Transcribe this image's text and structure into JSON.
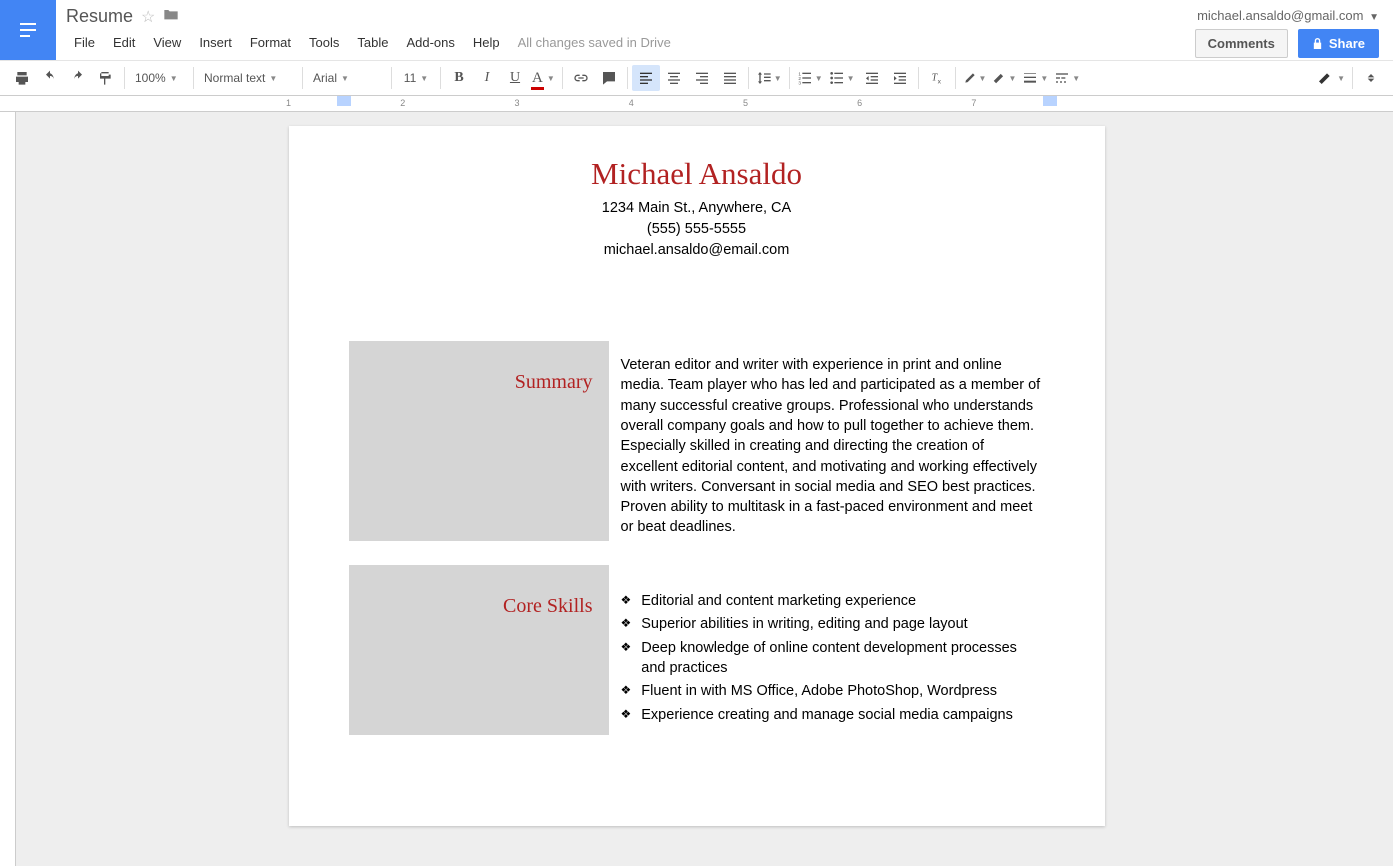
{
  "header": {
    "doc_title": "Resume",
    "user_email": "michael.ansaldo@gmail.com",
    "comments_btn": "Comments",
    "share_btn": "Share",
    "save_status": "All changes saved in Drive"
  },
  "menu": {
    "file": "File",
    "edit": "Edit",
    "view": "View",
    "insert": "Insert",
    "format": "Format",
    "tools": "Tools",
    "table": "Table",
    "addons": "Add-ons",
    "help": "Help"
  },
  "toolbar": {
    "zoom": "100%",
    "style": "Normal text",
    "font": "Arial",
    "size": "11"
  },
  "ruler": {
    "n1": "1",
    "n2": "2",
    "n3": "3",
    "n4": "4",
    "n5": "5",
    "n6": "6",
    "n7": "7"
  },
  "resume": {
    "name": "Michael Ansaldo",
    "address": "1234 Main St., Anywhere, CA",
    "phone": "(555) 555-5555",
    "email": "michael.ansaldo@email.com",
    "sections": {
      "summary": {
        "label": "Summary",
        "body": "Veteran editor and writer with experience in print and online media. Team player who has led and participated as a member of many successful creative groups. Professional who understands overall company goals and how to pull together to achieve them. Especially skilled in creating and directing the creation of excellent editorial content, and motivating and working effectively with writers. Conversant in social media and SEO best practices. Proven ability to multitask in a fast-paced environment and meet or beat deadlines."
      },
      "core_skills": {
        "label": "Core Skills",
        "items": [
          "Editorial and content marketing experience",
          "Superior abilities in writing, editing and page layout",
          "Deep knowledge of online content development processes and practices",
          "Fluent in with MS Office, Adobe PhotoShop, Wordpress",
          "Experience creating and manage social media campaigns"
        ]
      }
    }
  }
}
